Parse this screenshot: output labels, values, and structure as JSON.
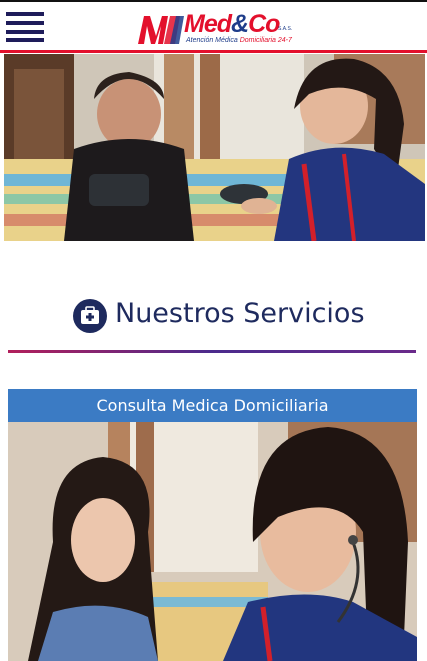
{
  "header": {
    "menu_icon": "hamburger-menu-icon",
    "logo": {
      "brand_main": "Med",
      "brand_amp": "&",
      "brand_co": "Co",
      "brand_suffix": "S.A.S.",
      "tagline_blue": "Atención Médica",
      "tagline_red": "Domiciliaria 24-7"
    },
    "accent_color": "#e3102c",
    "brand_blue": "#1f3d8a"
  },
  "hero": {
    "image_subject": "nurse-taking-blood-pressure-photo"
  },
  "section": {
    "icon": "medical-kit-icon",
    "title": "Nuestros Servicios"
  },
  "services": [
    {
      "title": "Consulta Medica Domiciliaria",
      "image_subject": "nurse-stethoscope-photo",
      "header_color": "#3b7bc4"
    }
  ]
}
